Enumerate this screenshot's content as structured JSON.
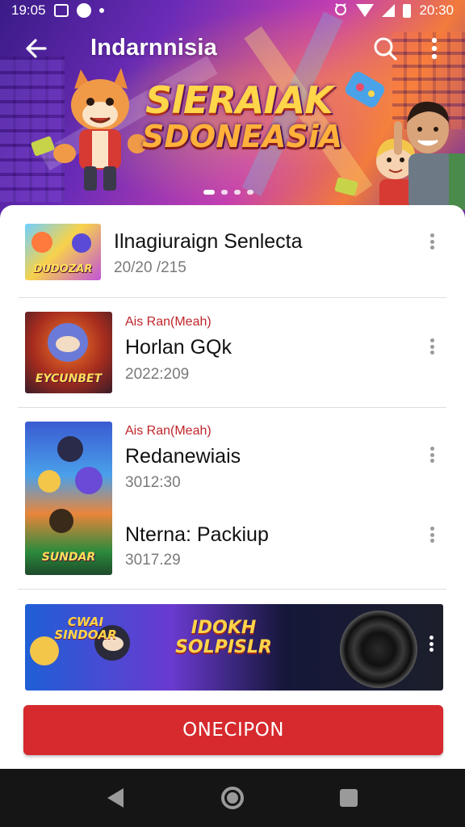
{
  "status_bar": {
    "time_left": "19:05",
    "time_right": "20:30",
    "icons": [
      "gallery-icon",
      "emoji-icon",
      "notification-dot-icon",
      "alarm-icon",
      "wifi-icon",
      "signal-icon",
      "battery-icon"
    ]
  },
  "app_bar": {
    "title": "Indarnnisia",
    "back_icon": "arrow-left-icon",
    "search_icon": "search-icon",
    "more_icon": "more-vertical-icon"
  },
  "hero": {
    "line1": "SlERAIAK",
    "line2": "SDONEASiA",
    "pager_count": 4,
    "pager_active": 0
  },
  "items": [
    {
      "title": "Ilnagiuraign Senlecta",
      "date": "20/20 /215",
      "thumb_label": "DUDOZAR"
    },
    {
      "tag": "Ais Ran(Meah)",
      "title": "Horlan GQk",
      "date": "2022:209",
      "thumb_label": "EYCUNBET"
    },
    {
      "tag": "Ais Ran(Meah)",
      "title": "Redanewiais",
      "date": "3012:30"
    },
    {
      "title": "Nterna: Packiup",
      "date": "3017.29",
      "thumb_label": "SUNDAR"
    }
  ],
  "banner": {
    "main_label": "IDOKH SOLPISLR",
    "left_label": "CWAI SINDOAR"
  },
  "cta": {
    "label": "ONECIPON"
  },
  "colors": {
    "accent_red": "#d62a2e",
    "tag_red": "#c0262a",
    "title_text": "#111111",
    "date_text": "#7a7a7a"
  },
  "nav_bar": {
    "icons": [
      "nav-back-icon",
      "nav-home-icon",
      "nav-recents-icon"
    ]
  }
}
